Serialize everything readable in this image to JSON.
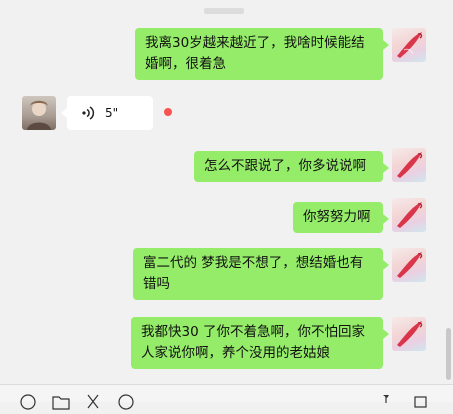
{
  "messages": [
    {
      "sender": "me",
      "type": "text",
      "text": "我离30岁越来越近了，我啥时候能结婚啊，很着急"
    },
    {
      "sender": "peer",
      "type": "voice",
      "duration": "5\"",
      "unread": true
    },
    {
      "sender": "me",
      "type": "text",
      "text": "怎么不跟说了，你多说说啊"
    },
    {
      "sender": "me",
      "type": "text",
      "text": "你努努力啊"
    },
    {
      "sender": "me",
      "type": "text",
      "text": "富二代的 梦我是不想了，想结婚也有错吗"
    },
    {
      "sender": "me",
      "type": "text",
      "text": "我都快30 了你不着急啊，你不怕回家人家说你啊，养个没用的老姑娘"
    }
  ],
  "toolbar_icons": [
    "emoji-icon",
    "folder-icon",
    "scissors-icon",
    "chat-bubble-icon",
    "microphone-icon",
    "video-call-icon"
  ],
  "colors": {
    "me_bubble": "#95ec69",
    "peer_bubble": "#ffffff",
    "background": "#f1f1f1",
    "unread_dot": "#fa5151"
  }
}
